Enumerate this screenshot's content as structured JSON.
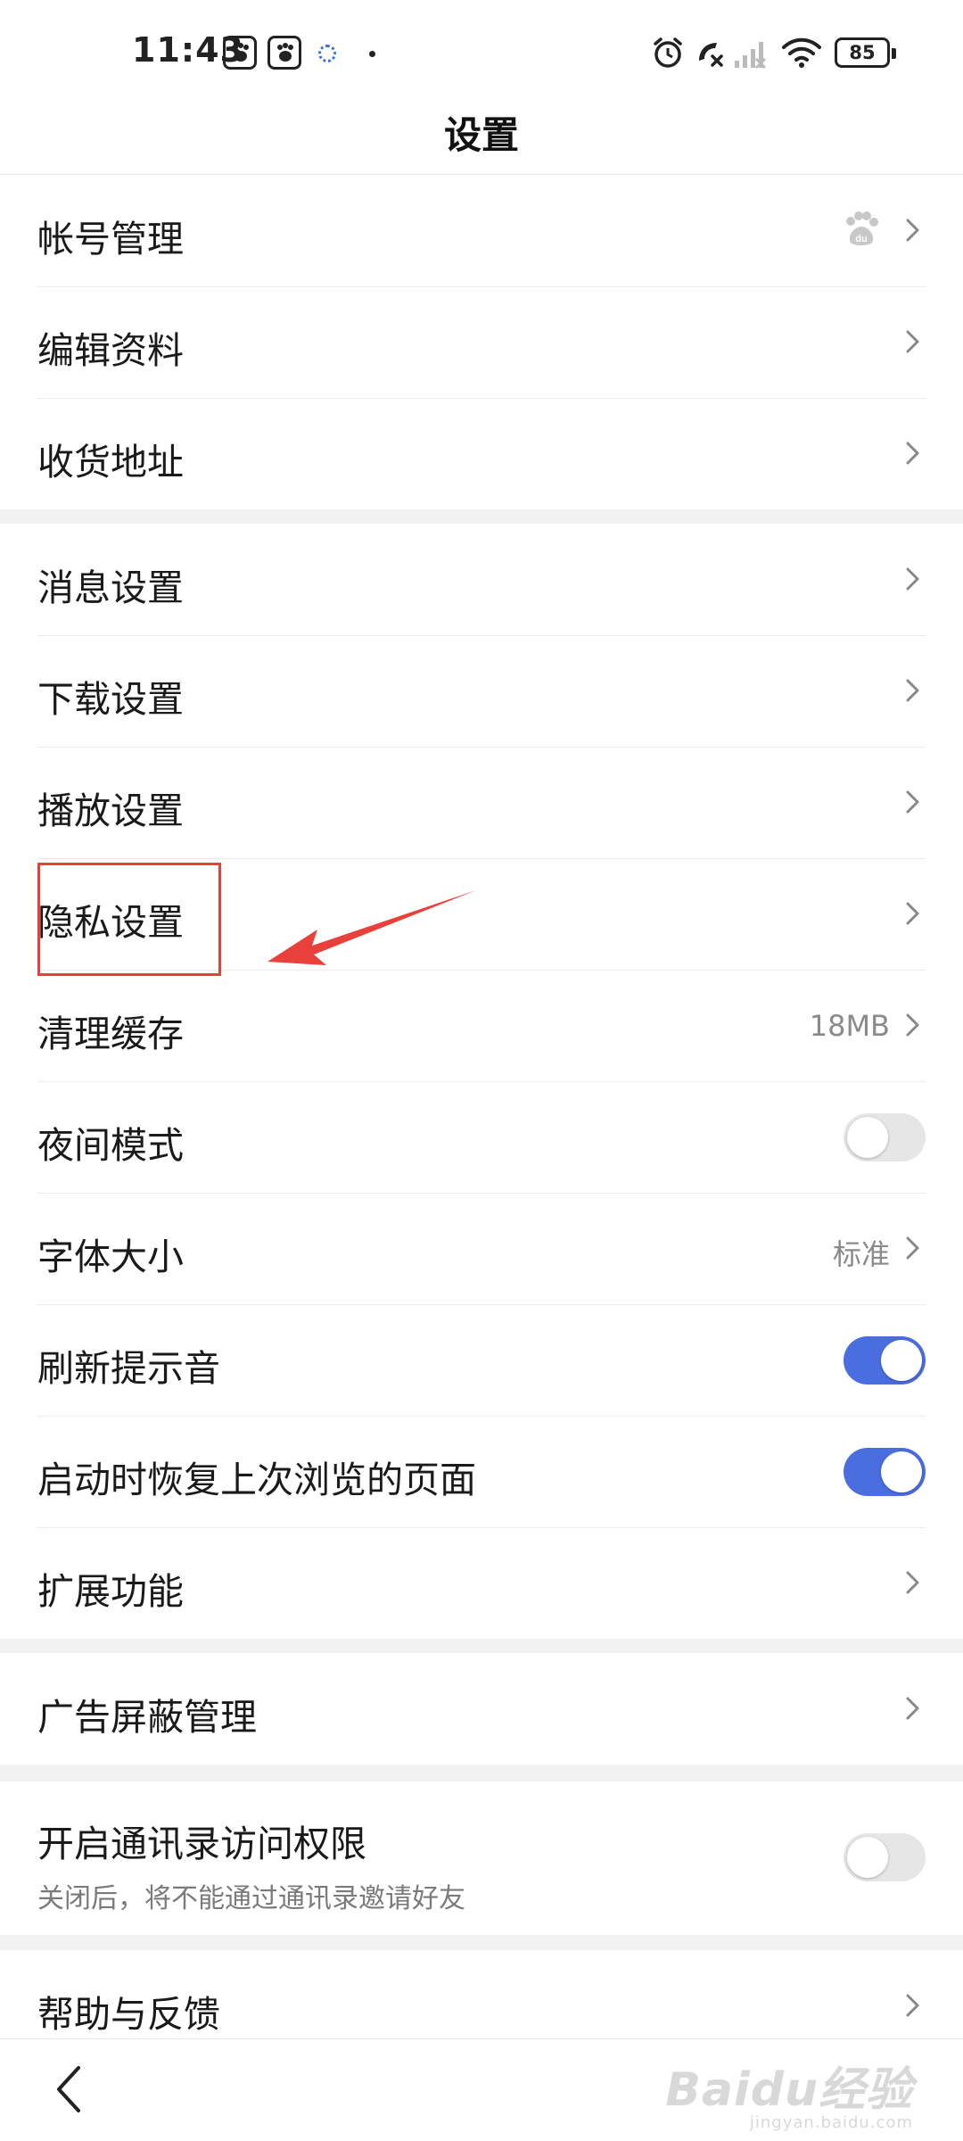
{
  "status_bar": {
    "time": "11:43",
    "battery": "85"
  },
  "header": {
    "title": "设置"
  },
  "groups": [
    {
      "items": [
        {
          "label": "帐号管理",
          "right_icon": "baidu-paw-icon"
        },
        {
          "label": "编辑资料"
        },
        {
          "label": "收货地址"
        }
      ]
    },
    {
      "items": [
        {
          "label": "消息设置"
        },
        {
          "label": "下载设置"
        },
        {
          "label": "播放设置"
        },
        {
          "label": "隐私设置"
        },
        {
          "label": "清理缓存",
          "value": "18MB"
        },
        {
          "label": "夜间模式",
          "toggle": false
        },
        {
          "label": "字体大小",
          "value": "标准"
        },
        {
          "label": "刷新提示音",
          "toggle": true
        },
        {
          "label": "启动时恢复上次浏览的页面",
          "toggle": true
        },
        {
          "label": "扩展功能"
        }
      ]
    },
    {
      "items": [
        {
          "label": "广告屏蔽管理"
        }
      ]
    },
    {
      "items": [
        {
          "label": "开启通讯录访问权限",
          "sublabel": "关闭后，将不能通过通讯录邀请好友",
          "toggle": false
        }
      ]
    },
    {
      "items": [
        {
          "label": "帮助与反馈"
        }
      ]
    }
  ],
  "colors": {
    "toggle_on": "#4a6ee0",
    "toggle_off": "#e6e6e6",
    "annotation": "#e8413c"
  },
  "watermark": {
    "main": "Baidu经验",
    "sub": "jingyan.baidu.com"
  }
}
